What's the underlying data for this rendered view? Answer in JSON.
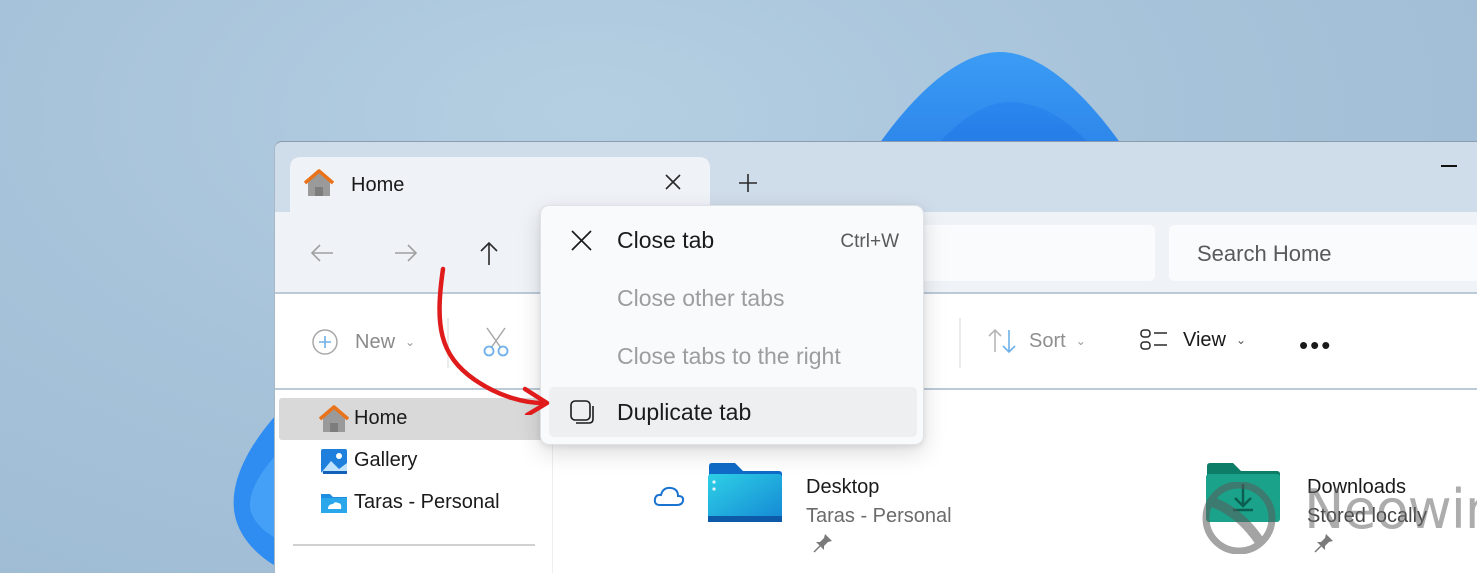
{
  "window": {
    "tab": {
      "title": "Home",
      "icon": "home-icon"
    },
    "new_tab_icon": "plus-icon",
    "minimize_icon": "minimize-icon"
  },
  "navbar": {
    "back_icon": "arrow-left-icon",
    "forward_icon": "arrow-right-icon",
    "up_icon": "arrow-up-icon",
    "address_value": "",
    "search_placeholder": "Search Home"
  },
  "toolbar": {
    "new_label": "New",
    "sort_label": "Sort",
    "view_label": "View",
    "more_label": "•••"
  },
  "sidebar": {
    "items": [
      {
        "label": "Home",
        "icon": "home-icon",
        "selected": true
      },
      {
        "label": "Gallery",
        "icon": "gallery-icon",
        "selected": false
      },
      {
        "label": "Taras - Personal",
        "icon": "onedrive-folder-icon",
        "selected": false
      }
    ]
  },
  "quick_access": [
    {
      "name": "Desktop",
      "location": "Taras - Personal",
      "status_icon": "cloud-icon",
      "pinned": true
    },
    {
      "name": "Downloads",
      "location": "Stored locally",
      "status_icon": "",
      "pinned": true
    }
  ],
  "context_menu": {
    "items": [
      {
        "label": "Close tab",
        "shortcut": "Ctrl+W",
        "icon": "close-icon",
        "enabled": true
      },
      {
        "label": "Close other tabs",
        "shortcut": "",
        "icon": "",
        "enabled": false
      },
      {
        "label": "Close tabs to the right",
        "shortcut": "",
        "icon": "",
        "enabled": false
      },
      {
        "label": "Duplicate tab",
        "shortcut": "",
        "icon": "duplicate-icon",
        "enabled": true,
        "highlighted": true
      }
    ]
  },
  "watermark": {
    "text": "Neowin"
  },
  "colors": {
    "accent_orange": "#e8731a",
    "folder_blue": "#1e9ad6",
    "downloads_teal": "#1aa38a",
    "annotation_red": "#e01b1b",
    "cloud_blue": "#1a73d0"
  }
}
